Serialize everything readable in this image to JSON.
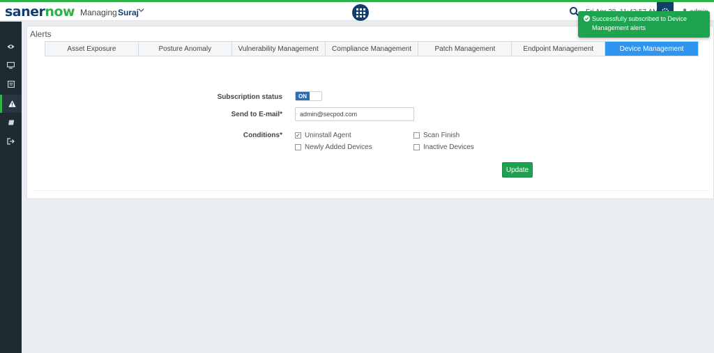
{
  "app": {
    "logo_part1": "saner",
    "logo_part2": "now"
  },
  "header": {
    "managing_label": "Managing",
    "org_name": "Suraj",
    "datetime": "Fri Apr 28, 11:43:57 AM",
    "user": "admin"
  },
  "sidebar": {
    "items": [
      {
        "icon": "eye-icon"
      },
      {
        "icon": "monitor-icon"
      },
      {
        "icon": "report-icon"
      },
      {
        "icon": "alert-icon",
        "active": true
      },
      {
        "icon": "book-icon"
      },
      {
        "icon": "logout-icon"
      }
    ]
  },
  "page": {
    "title": "Alerts"
  },
  "tabs": [
    {
      "label": "Asset Exposure"
    },
    {
      "label": "Posture Anomaly"
    },
    {
      "label": "Vulnerability Management"
    },
    {
      "label": "Compliance Management"
    },
    {
      "label": "Patch Management"
    },
    {
      "label": "Endpoint Management"
    },
    {
      "label": "Device Management"
    }
  ],
  "form": {
    "subscription_label": "Subscription status",
    "toggle_text": "ON",
    "email_label": "Send to E-mail*",
    "email_value": "admin@secpod.com",
    "conditions_label": "Conditions*",
    "conditions": [
      {
        "label": "Uninstall Agent",
        "checked": true
      },
      {
        "label": "Scan Finish",
        "checked": false
      },
      {
        "label": "Newly Added Devices",
        "checked": false
      },
      {
        "label": "Inactive Devices",
        "checked": false
      }
    ],
    "update_label": "Update"
  },
  "toast": {
    "message": "Successfully subscribed to Device Management alerts"
  },
  "colors": {
    "brand_navy": "#123e6c",
    "brand_green": "#2fb24a",
    "tab_active": "#2e96f0",
    "toast_green": "#1ea34f"
  }
}
